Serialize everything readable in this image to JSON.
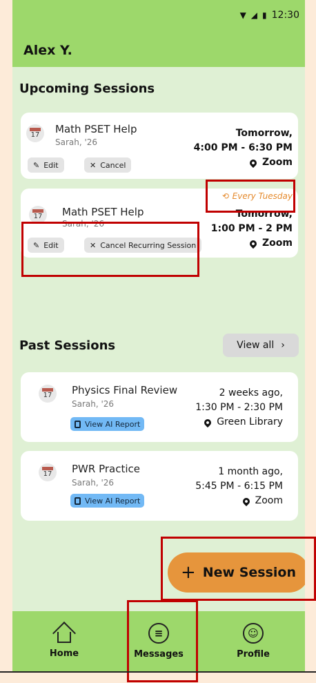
{
  "status_bar": {
    "time": "12:30",
    "icons": [
      "wifi-icon",
      "signal-icon",
      "battery-icon"
    ]
  },
  "header": {
    "user_name": "Alex Y."
  },
  "upcoming": {
    "title": "Upcoming Sessions",
    "sessions": [
      {
        "calendar_day": "17",
        "title": "Math PSET Help",
        "subtitle": "Sarah, '26",
        "when_line1": "Tomorrow,",
        "when_line2": "4:00 PM - 6:30 PM",
        "location": "Zoom",
        "edit_label": "Edit",
        "cancel_label": "Cancel"
      },
      {
        "calendar_day": "17",
        "title": "Math PSET Help",
        "subtitle": "Sarah, '26",
        "recurring": "Every Tuesday",
        "when_line1": "Tomorrow,",
        "when_line2": "1:00 PM - 2 PM",
        "location": "Zoom",
        "edit_label": "Edit",
        "cancel_label": "Cancel Recurring Session"
      }
    ]
  },
  "past": {
    "title": "Past Sessions",
    "view_all": "View all",
    "sessions": [
      {
        "calendar_day": "17",
        "title": "Physics Final Review",
        "subtitle": "Sarah, '26",
        "when_line1": "2 weeks ago,",
        "when_line2": "1:30 PM - 2:30 PM",
        "location": "Green Library",
        "report_label": "View AI Report"
      },
      {
        "calendar_day": "17",
        "title": "PWR Practice",
        "subtitle": "Sarah, '26",
        "when_line1": "1 month ago,",
        "when_line2": "5:45 PM - 6:15 PM",
        "location": "Zoom",
        "report_label": "View AI Report"
      }
    ]
  },
  "fab": {
    "label": "New Session"
  },
  "nav": [
    {
      "label": "Home",
      "icon": "home-icon"
    },
    {
      "label": "Messages",
      "icon": "messages-icon"
    },
    {
      "label": "Profile",
      "icon": "profile-icon"
    }
  ],
  "colors": {
    "green_bar": "#9dd86b",
    "background": "#dff0d4",
    "accent_orange": "#e6953c",
    "highlight_red": "#c00000"
  }
}
